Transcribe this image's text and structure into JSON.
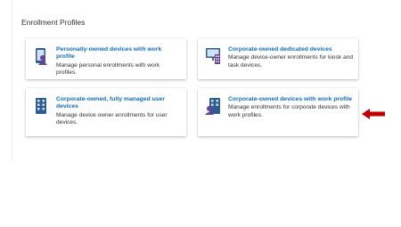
{
  "page": {
    "heading": "Enrollment Profiles"
  },
  "cards": [
    {
      "title": "Personally-owned devices with work profile",
      "description": "Manage personal enrollments with work profiles.",
      "icon": "personal-device-icon"
    },
    {
      "title": "Corporate-owned dedicated devices",
      "description": "Manage device-owner enrollments for kiosk and task devices.",
      "icon": "dedicated-device-icon"
    },
    {
      "title": "Corporate-owned, fully managed user devices",
      "description": "Manage device owner enrollments for user devices.",
      "icon": "fully-managed-device-icon"
    },
    {
      "title": "Corporate-owned devices with work profile",
      "description": "Manage enrollments for corporate devices with work profiles.",
      "icon": "corporate-work-profile-icon"
    }
  ],
  "colors": {
    "link": "#0f6cbd",
    "text": "#323130",
    "arrow": "#c00000",
    "purple": "#6b3fa0",
    "device_blue": "#2f5c8f"
  }
}
